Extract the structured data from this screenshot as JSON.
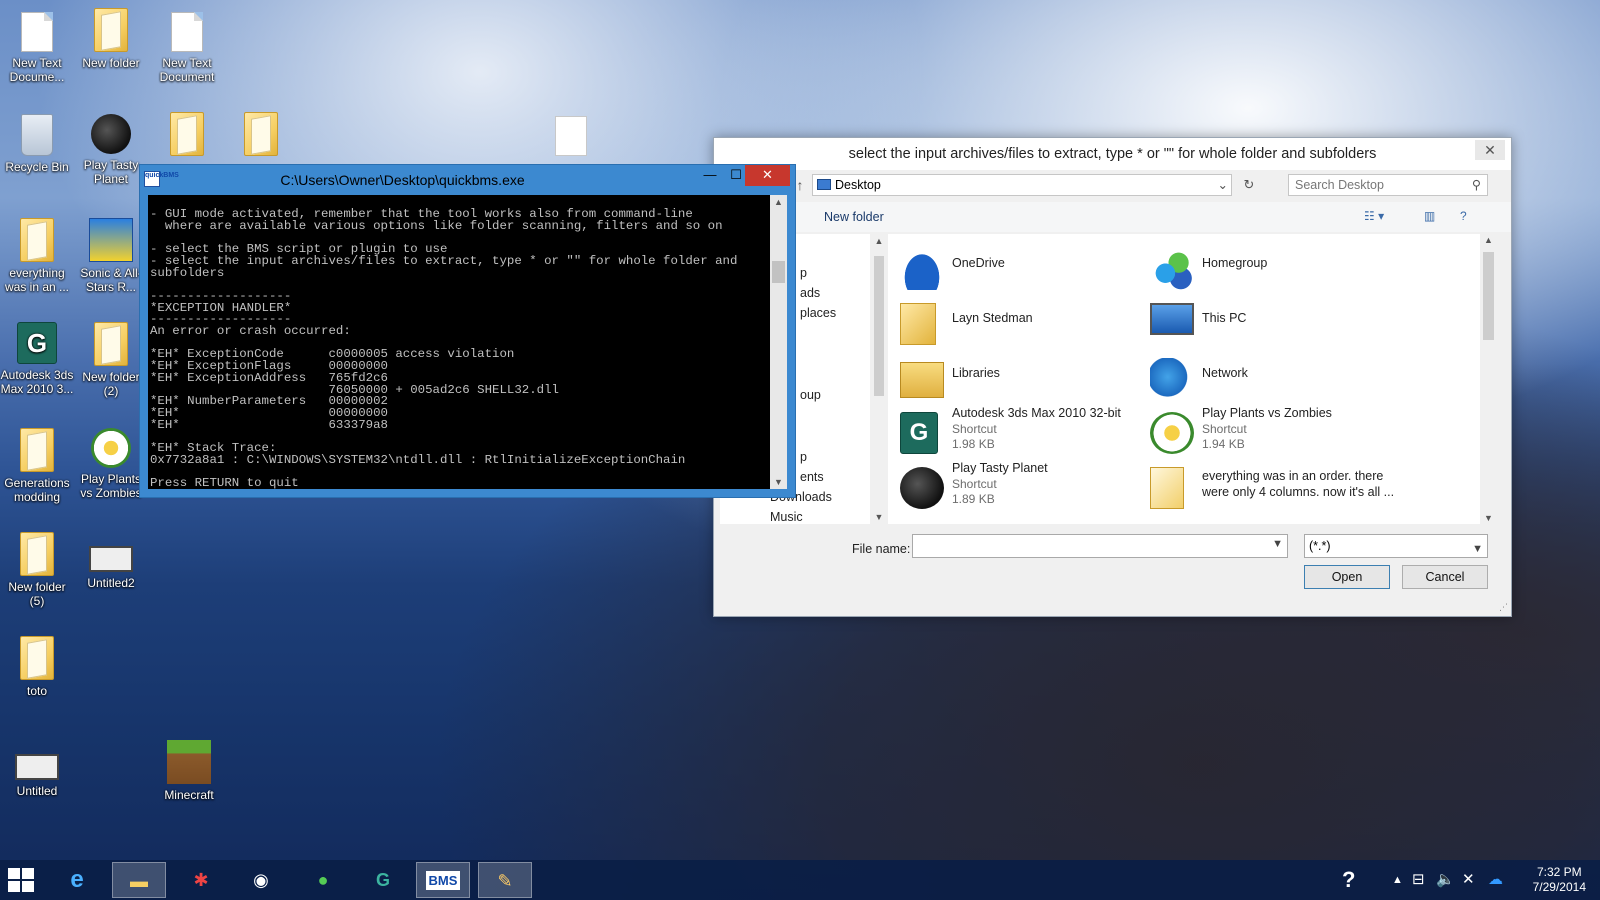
{
  "desktop": {
    "icons": [
      {
        "label": "New Text Docume...",
        "icon": "text-document-icon"
      },
      {
        "label": "New folder",
        "icon": "folder-icon"
      },
      {
        "label": "New Text Document",
        "icon": "text-document-icon"
      },
      {
        "label": "Recycle Bin",
        "icon": "recycle-bin-icon"
      },
      {
        "label": "Play Tasty Planet",
        "icon": "tasty-planet-icon"
      },
      {
        "label": "everything was in an ...",
        "icon": "folder-icon"
      },
      {
        "label": "Sonic & All-Stars R...",
        "icon": "sonic-icon"
      },
      {
        "label": "Autodesk 3ds Max 2010 3...",
        "icon": "3ds-max-icon"
      },
      {
        "label": "New folder (2)",
        "icon": "folder-icon"
      },
      {
        "label": "Generations modding",
        "icon": "folder-icon"
      },
      {
        "label": "Play Plants vs Zombies",
        "icon": "plants-vs-zombies-icon"
      },
      {
        "label": "New folder (5)",
        "icon": "folder-icon"
      },
      {
        "label": "Untitled2",
        "icon": "monitor-icon"
      },
      {
        "label": "toto",
        "icon": "folder-icon"
      },
      {
        "label": "Untitled",
        "icon": "monitor-icon"
      },
      {
        "label": "Minecraft",
        "icon": "minecraft-icon"
      }
    ]
  },
  "console": {
    "title": "C:\\Users\\Owner\\Desktop\\quickbms.exe",
    "app_icon_text": "quickBMS",
    "minimize": "—",
    "maximize": "☐",
    "close": "✕",
    "output": "- GUI mode activated, remember that the tool works also from command-line\n  where are available various options like folder scanning, filters and so on\n\n- select the BMS script or plugin to use\n- select the input archives/files to extract, type * or \"\" for whole folder and\nsubfolders\n\n-------------------\n*EXCEPTION HANDLER*\n-------------------\nAn error or crash occurred:\n\n*EH* ExceptionCode      c0000005 access violation\n*EH* ExceptionFlags     00000000\n*EH* ExceptionAddress   765fd2c6\n                        76050000 + 005ad2c6 SHELL32.dll\n*EH* NumberParameters   00000002\n*EH*                    00000000\n*EH*                    633379a8\n\n*EH* Stack Trace:\n0x7732a8a1 : C:\\WINDOWS\\SYSTEM32\\ntdll.dll : RtlInitializeExceptionChain\n\nPress RETURN to quit"
  },
  "dialog": {
    "title": "select the input archives/files to extract, type * or \"\" for whole folder and subfolders",
    "close": "✕",
    "address": "Desktop",
    "search_placeholder": "Search Desktop",
    "new_folder": "New folder",
    "nav_items": [
      "p",
      "ads",
      "places",
      "oup",
      "p",
      "ents",
      "Downloads",
      "Music"
    ],
    "files": [
      {
        "name": "OneDrive",
        "type": "",
        "size": "",
        "icon": "onedrive-icon"
      },
      {
        "name": "Homegroup",
        "type": "",
        "size": "",
        "icon": "homegroup-icon"
      },
      {
        "name": "Layn Stedman",
        "type": "",
        "size": "",
        "icon": "user-folder-icon"
      },
      {
        "name": "This PC",
        "type": "",
        "size": "",
        "icon": "this-pc-icon"
      },
      {
        "name": "Libraries",
        "type": "",
        "size": "",
        "icon": "libraries-icon"
      },
      {
        "name": "Network",
        "type": "",
        "size": "",
        "icon": "network-icon"
      },
      {
        "name": "Autodesk 3ds Max 2010 32-bit",
        "type": "Shortcut",
        "size": "1.98 KB",
        "icon": "3ds-max-icon"
      },
      {
        "name": "Play Plants vs Zombies",
        "type": "Shortcut",
        "size": "1.94 KB",
        "icon": "plants-vs-zombies-icon"
      },
      {
        "name": "Play Tasty Planet",
        "type": "Shortcut",
        "size": "1.89 KB",
        "icon": "tasty-planet-icon"
      },
      {
        "name": "everything was in an order. there",
        "type": "were only 4 columns. now it's all ...",
        "size": "",
        "icon": "folder-icon"
      }
    ],
    "file_name_label": "File name:",
    "file_name_value": "",
    "file_type": "(*.*)",
    "open": "Open",
    "cancel": "Cancel"
  },
  "taskbar": {
    "apps": [
      "internet-explorer-icon",
      "file-explorer-icon",
      "puzzle-app-icon",
      "media-app-icon",
      "tennis-ball-app-icon",
      "3ds-max-icon",
      "quickbms-icon",
      "paint-icon"
    ],
    "quickbms_label": "BMS",
    "clock_time": "7:32 PM",
    "clock_date": "7/29/2014"
  }
}
